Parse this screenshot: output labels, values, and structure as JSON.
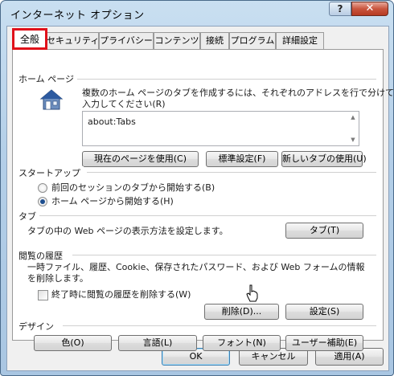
{
  "window": {
    "title": "インターネット オプション",
    "help_label": "?",
    "close_label": "✕"
  },
  "tabs": [
    {
      "label": "全般",
      "active": true
    },
    {
      "label": "セキュリティ",
      "active": false
    },
    {
      "label": "プライバシー",
      "active": false
    },
    {
      "label": "コンテンツ",
      "active": false
    },
    {
      "label": "接続",
      "active": false
    },
    {
      "label": "プログラム",
      "active": false
    },
    {
      "label": "詳細設定",
      "active": false
    }
  ],
  "home_page": {
    "group_title": "ホーム ページ",
    "description_line1": "複数のホーム ページのタブを作成するには、それぞれのアドレスを行で分けて",
    "description_line2": "入力してください(R)",
    "textarea_value": "about:Tabs",
    "buttons": {
      "use_current": "現在のページを使用(C)",
      "use_default": "標準設定(F)",
      "use_new_tab": "新しいタブの使用(U)"
    }
  },
  "startup": {
    "group_title": "スタートアップ",
    "option_previous": "前回のセッションのタブから開始する(B)",
    "option_home": "ホーム ページから開始する(H)",
    "selected": "home"
  },
  "tabs_group": {
    "group_title": "タブ",
    "description": "タブの中の Web ページの表示方法を設定します。",
    "button": "タブ(T)"
  },
  "history": {
    "group_title": "閲覧の履歴",
    "description_line1": "一時ファイル、履歴、Cookie、保存されたパスワード、および Web フォームの情報",
    "description_line2": "を削除します。",
    "checkbox_label": "終了時に閲覧の履歴を削除する(W)",
    "checkbox_checked": false,
    "delete_button": "削除(D)...",
    "settings_button": "設定(S)"
  },
  "design": {
    "group_title": "デザイン",
    "colors_button": "色(O)",
    "languages_button": "言語(L)",
    "fonts_button": "フォント(N)",
    "accessibility_button": "ユーザー補助(E)"
  },
  "footer": {
    "ok": "OK",
    "cancel": "キャンセル",
    "apply": "適用(A)"
  },
  "icons": {
    "home": "house-icon",
    "cursor": "hand-pointer-icon"
  },
  "colors": {
    "highlight": "#e0111a",
    "titlebar": "#b4cfe8",
    "close_button": "#c9553e"
  }
}
